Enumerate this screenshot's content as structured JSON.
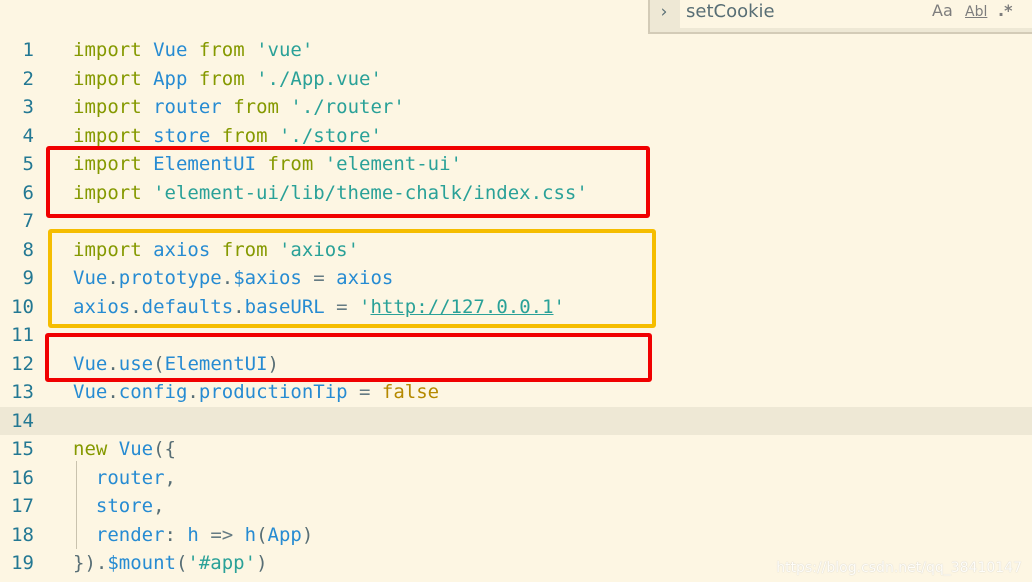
{
  "find": {
    "toggle_label": "›",
    "query": "setCookie",
    "match_case_label": "Aa",
    "whole_word_label": "Abl",
    "regex_label": ".*"
  },
  "lines": [
    {
      "n": "1"
    },
    {
      "n": "2"
    },
    {
      "n": "3"
    },
    {
      "n": "4"
    },
    {
      "n": "5"
    },
    {
      "n": "6"
    },
    {
      "n": "7"
    },
    {
      "n": "8"
    },
    {
      "n": "9"
    },
    {
      "n": "10"
    },
    {
      "n": "11"
    },
    {
      "n": "12"
    },
    {
      "n": "13"
    },
    {
      "n": "14"
    },
    {
      "n": "15"
    },
    {
      "n": "16"
    },
    {
      "n": "17"
    },
    {
      "n": "18"
    },
    {
      "n": "19"
    }
  ],
  "code": [
    [
      [
        "kw",
        "import"
      ],
      [
        "op",
        " "
      ],
      [
        "id",
        "Vue"
      ],
      [
        "op",
        " "
      ],
      [
        "kw",
        "from"
      ],
      [
        "op",
        " "
      ],
      [
        "str",
        "'vue'"
      ]
    ],
    [
      [
        "kw",
        "import"
      ],
      [
        "op",
        " "
      ],
      [
        "id",
        "App"
      ],
      [
        "op",
        " "
      ],
      [
        "kw",
        "from"
      ],
      [
        "op",
        " "
      ],
      [
        "str",
        "'./App.vue'"
      ]
    ],
    [
      [
        "kw",
        "import"
      ],
      [
        "op",
        " "
      ],
      [
        "id",
        "router"
      ],
      [
        "op",
        " "
      ],
      [
        "kw",
        "from"
      ],
      [
        "op",
        " "
      ],
      [
        "str",
        "'./router'"
      ]
    ],
    [
      [
        "kw",
        "import"
      ],
      [
        "op",
        " "
      ],
      [
        "id",
        "store"
      ],
      [
        "op",
        " "
      ],
      [
        "kw",
        "from"
      ],
      [
        "op",
        " "
      ],
      [
        "str",
        "'./store'"
      ]
    ],
    [
      [
        "kw",
        "import"
      ],
      [
        "op",
        " "
      ],
      [
        "id",
        "ElementUI"
      ],
      [
        "op",
        " "
      ],
      [
        "kw",
        "from"
      ],
      [
        "op",
        " "
      ],
      [
        "str",
        "'element-ui'"
      ]
    ],
    [
      [
        "kw",
        "import"
      ],
      [
        "op",
        " "
      ],
      [
        "str",
        "'element-ui/lib/theme-chalk/index.css'"
      ]
    ],
    [],
    [
      [
        "kw",
        "import"
      ],
      [
        "op",
        " "
      ],
      [
        "id",
        "axios"
      ],
      [
        "op",
        " "
      ],
      [
        "kw",
        "from"
      ],
      [
        "op",
        " "
      ],
      [
        "str",
        "'axios'"
      ]
    ],
    [
      [
        "id",
        "Vue"
      ],
      [
        "punc",
        "."
      ],
      [
        "id",
        "prototype"
      ],
      [
        "punc",
        "."
      ],
      [
        "id",
        "$axios"
      ],
      [
        "op",
        " = "
      ],
      [
        "id",
        "axios"
      ]
    ],
    [
      [
        "id",
        "axios"
      ],
      [
        "punc",
        "."
      ],
      [
        "id",
        "defaults"
      ],
      [
        "punc",
        "."
      ],
      [
        "id",
        "baseURL"
      ],
      [
        "op",
        " = "
      ],
      [
        "str",
        "'"
      ],
      [
        "link",
        "http://127.0.0.1"
      ],
      [
        "str",
        "'"
      ]
    ],
    [],
    [
      [
        "id",
        "Vue"
      ],
      [
        "punc",
        "."
      ],
      [
        "id",
        "use"
      ],
      [
        "punc",
        "("
      ],
      [
        "id",
        "ElementUI"
      ],
      [
        "punc",
        ")"
      ]
    ],
    [
      [
        "id",
        "Vue"
      ],
      [
        "punc",
        "."
      ],
      [
        "id",
        "config"
      ],
      [
        "punc",
        "."
      ],
      [
        "id",
        "productionTip"
      ],
      [
        "op",
        " = "
      ],
      [
        "bool",
        "false"
      ]
    ],
    [],
    [
      [
        "kw",
        "new"
      ],
      [
        "op",
        " "
      ],
      [
        "id",
        "Vue"
      ],
      [
        "punc",
        "({"
      ]
    ],
    [
      [
        "op",
        "  "
      ],
      [
        "id",
        "router"
      ],
      [
        "punc",
        ","
      ]
    ],
    [
      [
        "op",
        "  "
      ],
      [
        "id",
        "store"
      ],
      [
        "punc",
        ","
      ]
    ],
    [
      [
        "op",
        "  "
      ],
      [
        "id",
        "render"
      ],
      [
        "punc",
        ": "
      ],
      [
        "id",
        "h"
      ],
      [
        "op",
        " => "
      ],
      [
        "id",
        "h"
      ],
      [
        "punc",
        "("
      ],
      [
        "id",
        "App"
      ],
      [
        "punc",
        ")"
      ]
    ],
    [
      [
        "punc",
        "})."
      ],
      [
        "id",
        "$mount"
      ],
      [
        "punc",
        "("
      ],
      [
        "str",
        "'#app'"
      ],
      [
        "punc",
        ")"
      ]
    ]
  ],
  "current_line": "14",
  "watermark": "https://blog.csdn.net/qq_38410147",
  "colors": {
    "background": "#fdf6e3",
    "keyword": "#859900",
    "identifier": "#268bd2",
    "string": "#2aa198",
    "boolean": "#b58900",
    "highlight_red": "#f00000",
    "highlight_yellow": "#f5bd00"
  }
}
